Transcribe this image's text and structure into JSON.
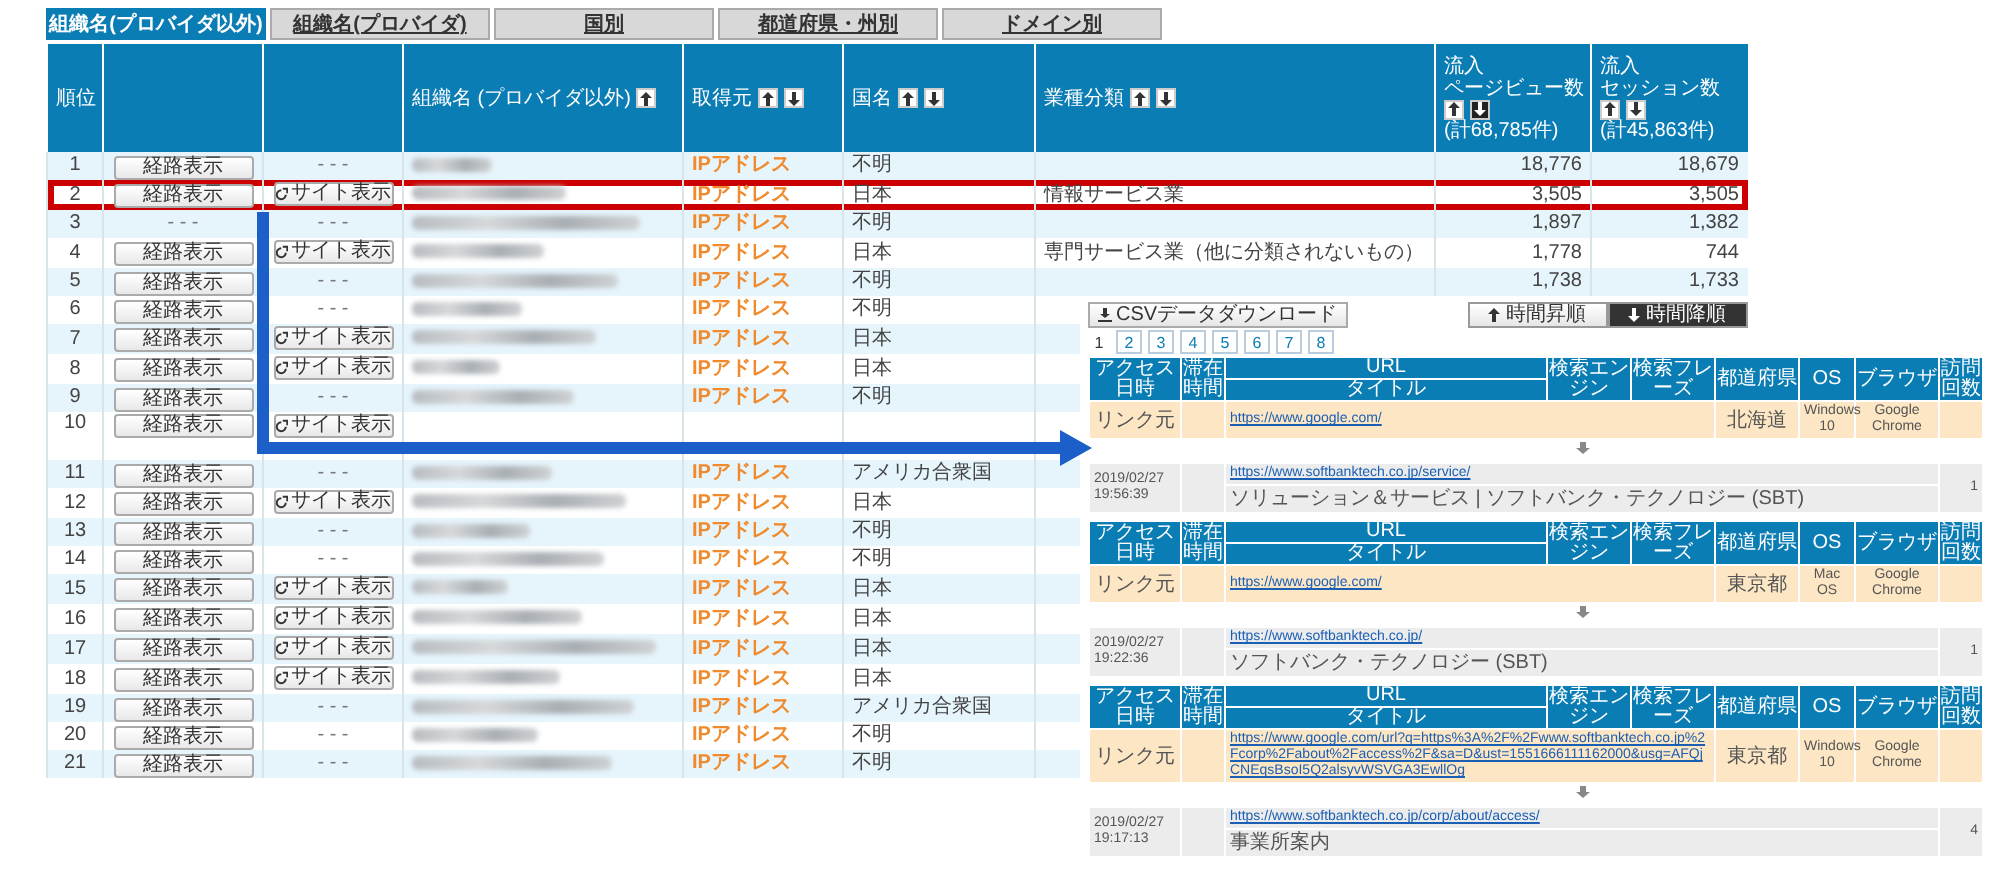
{
  "tabs": [
    {
      "label": "組織名(プロバイダ以外)",
      "selected": true
    },
    {
      "label": "組織名(プロバイダ)",
      "selected": false
    },
    {
      "label": "国別",
      "selected": false
    },
    {
      "label": "都道府県・州別",
      "selected": false
    },
    {
      "label": "ドメイン別",
      "selected": false
    }
  ],
  "table": {
    "columns": [
      {
        "label_lines": [
          "順位"
        ]
      },
      {},
      {},
      {
        "label_lines": [
          "組織名 (プロバイダ以外)"
        ],
        "sort": [
          {
            "kind": "up",
            "selected": false
          }
        ]
      },
      {
        "label_lines": [
          "取得元"
        ],
        "sort": [
          {
            "kind": "up",
            "selected": false
          },
          {
            "kind": "down",
            "selected": false
          }
        ]
      },
      {
        "label_lines": [
          "国名"
        ],
        "sort": [
          {
            "kind": "up",
            "selected": false
          },
          {
            "kind": "down",
            "selected": false
          }
        ]
      },
      {
        "label_lines": [
          "業種分類"
        ],
        "sort": [
          {
            "kind": "up",
            "selected": false
          },
          {
            "kind": "down",
            "selected": false
          }
        ]
      },
      {
        "label_lines": [
          "流入",
          "ページビュー数"
        ],
        "sort": [
          {
            "kind": "up",
            "selected": false
          },
          {
            "kind": "down",
            "selected": true
          }
        ],
        "total": "(計68,785件)"
      },
      {
        "label_lines": [
          "流入",
          "セッション数"
        ],
        "sort": [
          {
            "kind": "up",
            "selected": false
          },
          {
            "kind": "down",
            "selected": false
          }
        ],
        "total": "(計45,863件)"
      }
    ],
    "rows": [
      {
        "rank": "1",
        "route": {
          "kind": "button",
          "label": "経路表示"
        },
        "site": {
          "kind": "dash",
          "label": "- - -"
        },
        "organization": {
          "kind": "blurred"
        },
        "source": "IPアドレス",
        "country": "不明",
        "pageviews": "18,776",
        "sessions": "18,679",
        "highlighted": false
      },
      {
        "rank": "2",
        "route": {
          "kind": "button",
          "label": "経路表示"
        },
        "site": {
          "kind": "button",
          "label": "サイト表示"
        },
        "organization": {
          "kind": "blurred"
        },
        "source": "IPアドレス",
        "country": "日本",
        "industry": "情報サービス業",
        "pageviews": "3,505",
        "sessions": "3,505",
        "highlighted": true
      },
      {
        "rank": "3",
        "route": {
          "kind": "dash",
          "label": "- - -"
        },
        "site": {
          "kind": "dash",
          "label": "- - -"
        },
        "organization": {
          "kind": "blurred"
        },
        "source": "IPアドレス",
        "country": "不明",
        "pageviews": "1,897",
        "sessions": "1,382",
        "highlighted": false
      },
      {
        "rank": "4",
        "route": {
          "kind": "button",
          "label": "経路表示"
        },
        "site": {
          "kind": "button",
          "label": "サイト表示"
        },
        "organization": {
          "kind": "blurred"
        },
        "source": "IPアドレス",
        "country": "日本",
        "industry": "専門サービス業（他に分類されないもの）",
        "pageviews": "1,778",
        "sessions": "744",
        "highlighted": false
      },
      {
        "rank": "5",
        "route": {
          "kind": "button",
          "label": "経路表示"
        },
        "site": {
          "kind": "dash",
          "label": "- - -"
        },
        "organization": {
          "kind": "blurred"
        },
        "source": "IPアドレス",
        "country": "不明",
        "pageviews": "1,738",
        "sessions": "1,733",
        "highlighted": false
      },
      {
        "rank": "6",
        "route": {
          "kind": "button",
          "label": "経路表示"
        },
        "site": {
          "kind": "dash",
          "label": "- - -"
        },
        "organization": {
          "kind": "blurred"
        },
        "source": "IPアドレス",
        "country": "不明",
        "highlighted": false
      },
      {
        "rank": "7",
        "route": {
          "kind": "button",
          "label": "経路表示"
        },
        "site": {
          "kind": "button",
          "label": "サイト表示"
        },
        "organization": {
          "kind": "blurred"
        },
        "source": "IPアドレス",
        "country": "日本",
        "highlighted": false
      },
      {
        "rank": "8",
        "route": {
          "kind": "button",
          "label": "経路表示"
        },
        "site": {
          "kind": "button",
          "label": "サイト表示"
        },
        "organization": {
          "kind": "blurred"
        },
        "source": "IPアドレス",
        "country": "日本",
        "highlighted": false
      },
      {
        "rank": "9",
        "route": {
          "kind": "button",
          "label": "経路表示"
        },
        "site": {
          "kind": "dash",
          "label": "- - -"
        },
        "organization": {
          "kind": "blurred"
        },
        "source": "IPアドレス",
        "country": "不明",
        "highlighted": false
      },
      {
        "rank": "10",
        "route": {
          "kind": "button",
          "label": "経路表示"
        },
        "site": {
          "kind": "button",
          "label": "サイト表示"
        },
        "highlighted": false
      },
      {
        "rank": "11",
        "route": {
          "kind": "button",
          "label": "経路表示"
        },
        "site": {
          "kind": "dash",
          "label": "- - -"
        },
        "organization": {
          "kind": "blurred"
        },
        "source": "IPアドレス",
        "country": "アメリカ合衆国",
        "highlighted": false
      },
      {
        "rank": "12",
        "route": {
          "kind": "button",
          "label": "経路表示"
        },
        "site": {
          "kind": "button",
          "label": "サイト表示"
        },
        "organization": {
          "kind": "blurred"
        },
        "source": "IPアドレス",
        "country": "日本",
        "highlighted": false
      },
      {
        "rank": "13",
        "route": {
          "kind": "button",
          "label": "経路表示"
        },
        "site": {
          "kind": "dash",
          "label": "- - -"
        },
        "organization": {
          "kind": "blurred"
        },
        "source": "IPアドレス",
        "country": "不明",
        "highlighted": false
      },
      {
        "rank": "14",
        "route": {
          "kind": "button",
          "label": "経路表示"
        },
        "site": {
          "kind": "dash",
          "label": "- - -"
        },
        "organization": {
          "kind": "blurred"
        },
        "source": "IPアドレス",
        "country": "不明",
        "highlighted": false
      },
      {
        "rank": "15",
        "route": {
          "kind": "button",
          "label": "経路表示"
        },
        "site": {
          "kind": "button",
          "label": "サイト表示"
        },
        "organization": {
          "kind": "blurred"
        },
        "source": "IPアドレス",
        "country": "日本",
        "highlighted": false
      },
      {
        "rank": "16",
        "route": {
          "kind": "button",
          "label": "経路表示"
        },
        "site": {
          "kind": "button",
          "label": "サイト表示"
        },
        "organization": {
          "kind": "blurred"
        },
        "source": "IPアドレス",
        "country": "日本",
        "highlighted": false
      },
      {
        "rank": "17",
        "route": {
          "kind": "button",
          "label": "経路表示"
        },
        "site": {
          "kind": "button",
          "label": "サイト表示"
        },
        "organization": {
          "kind": "blurred"
        },
        "source": "IPアドレス",
        "country": "日本",
        "highlighted": false
      },
      {
        "rank": "18",
        "route": {
          "kind": "button",
          "label": "経路表示"
        },
        "site": {
          "kind": "button",
          "label": "サイト表示"
        },
        "organization": {
          "kind": "blurred"
        },
        "source": "IPアドレス",
        "country": "日本",
        "highlighted": false
      },
      {
        "rank": "19",
        "route": {
          "kind": "button",
          "label": "経路表示"
        },
        "site": {
          "kind": "dash",
          "label": "- - -"
        },
        "organization": {
          "kind": "blurred"
        },
        "source": "IPアドレス",
        "country": "アメリカ合衆国",
        "highlighted": false
      },
      {
        "rank": "20",
        "route": {
          "kind": "button",
          "label": "経路表示"
        },
        "site": {
          "kind": "dash",
          "label": "- - -"
        },
        "organization": {
          "kind": "blurred"
        },
        "source": "IPアドレス",
        "country": "不明",
        "highlighted": false
      },
      {
        "rank": "21",
        "route": {
          "kind": "button",
          "label": "経路表示"
        },
        "site": {
          "kind": "dash",
          "label": "- - -"
        },
        "organization": {
          "kind": "blurred"
        },
        "source": "IPアドレス",
        "country": "不明",
        "highlighted": false
      }
    ]
  },
  "panel": {
    "csv_button": "CSVデータダウンロード",
    "sort_buttons": [
      {
        "label": "時間昇順",
        "kind": "up",
        "selected": false
      },
      {
        "label": "時間降順",
        "kind": "down",
        "selected": true
      }
    ],
    "pages": [
      {
        "label": "1",
        "selected": true
      },
      {
        "label": "2",
        "selected": false
      },
      {
        "label": "3",
        "selected": false
      },
      {
        "label": "4",
        "selected": false
      },
      {
        "label": "5",
        "selected": false
      },
      {
        "label": "6",
        "selected": false
      },
      {
        "label": "7",
        "selected": false
      },
      {
        "label": "8",
        "selected": false
      }
    ],
    "sessions": [
      {
        "header": {
          "datetime": "アクセス日時",
          "stay": "滞在時間",
          "url": "URL",
          "title": "タイトル",
          "engine": "検索エンジン",
          "phrase": "検索フレーズ",
          "prefecture": "都道府県",
          "os": "OS",
          "browser": "ブラウザ",
          "visits": "訪問回数"
        },
        "referrer": {
          "label": "リンク元",
          "url": "https://www.google.com/",
          "prefecture": "北海道",
          "os": "Windows 10",
          "browser": "Google Chrome"
        },
        "visit": {
          "datetime": "2019/02/27 19:56:39",
          "url": "https://www.softbanktech.co.jp/service/",
          "title": "ソリューション＆サービス | ソフトバンク・テクノロジー (SBT)",
          "visits": "1"
        }
      },
      {
        "header": {
          "datetime": "アクセス日時",
          "stay": "滞在時間",
          "url": "URL",
          "title": "タイトル",
          "engine": "検索エンジン",
          "phrase": "検索フレーズ",
          "prefecture": "都道府県",
          "os": "OS",
          "browser": "ブラウザ",
          "visits": "訪問回数"
        },
        "referrer": {
          "label": "リンク元",
          "url": "https://www.google.com/",
          "prefecture": "東京都",
          "os": "Mac OS",
          "browser": "Google Chrome"
        },
        "visit": {
          "datetime": "2019/02/27 19:22:36",
          "url": "https://www.softbanktech.co.jp/",
          "title": "ソフトバンク・テクノロジー (SBT)",
          "visits": "1"
        }
      },
      {
        "header": {
          "datetime": "アクセス日時",
          "stay": "滞在時間",
          "url": "URL",
          "title": "タイトル",
          "engine": "検索エンジン",
          "phrase": "検索フレーズ",
          "prefecture": "都道府県",
          "os": "OS",
          "browser": "ブラウザ",
          "visits": "訪問回数"
        },
        "referrer": {
          "label": "リンク元",
          "url": "https://www.google.com/url?q=https%3A%2F%2Fwww.softbanktech.co.jp%2Fcorp%2Fabout%2Faccess%2F&sa=D&ust=1551666111162000&usg=AFQjCNEqsBsoI5Q2alsyvWSVGA3EwllOg",
          "prefecture": "東京都",
          "os": "Windows 10",
          "browser": "Google Chrome"
        },
        "visit": {
          "datetime": "2019/02/27 19:17:13",
          "url": "https://www.softbanktech.co.jp/corp/about/access/",
          "title": "事業所案内",
          "visits": "4"
        }
      }
    ]
  }
}
